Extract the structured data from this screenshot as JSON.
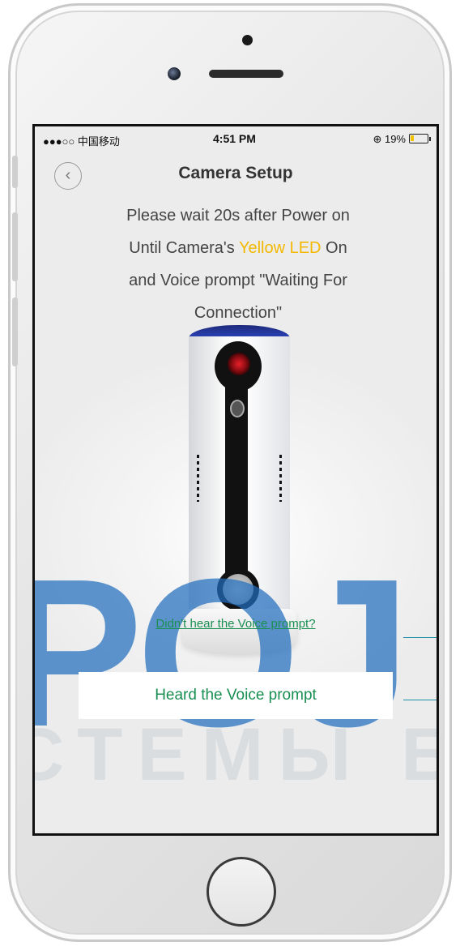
{
  "status_bar": {
    "carrier": "●●●○○ 中国移动",
    "time": "4:51 PM",
    "battery": "19%",
    "battery_level": 0.19
  },
  "nav": {
    "title": "Camera Setup",
    "back_icon": "chevron-left-icon"
  },
  "instructions": {
    "line1": "Please wait 20s after Power on",
    "line2_prefix": "Until Camera's ",
    "line2_highlight": "Yellow LED",
    "line2_suffix": " On",
    "line3": "and Voice prompt \"Waiting For",
    "line4": "Connection\""
  },
  "actions": {
    "help_link": "Didn't hear the Voice prompt?",
    "confirm_button": "Heard the Voice prompt"
  },
  "watermark": {
    "big": "POJ",
    "small": "СТЕМЫ БЕ"
  },
  "colors": {
    "accent_green": "#1a8f52",
    "highlight_yellow": "#f3b800",
    "watermark_blue": "#216ebe"
  }
}
